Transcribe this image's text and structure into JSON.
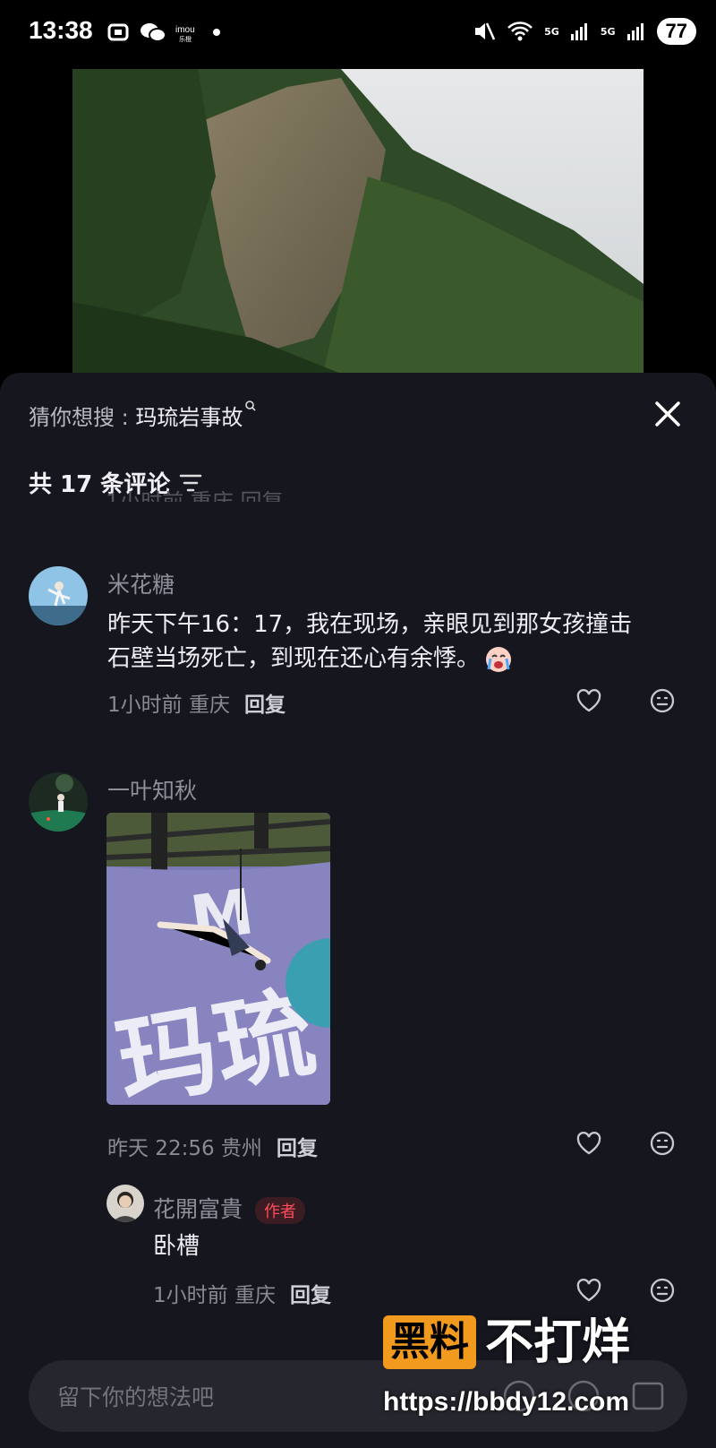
{
  "status_bar": {
    "time": "13:38",
    "battery": "77",
    "net1": "5G",
    "net2": "5G"
  },
  "sheet": {
    "suggest_prefix": "猜你想搜 : ",
    "suggest_keyword": "玛琉岩事故",
    "comment_count": "共 17 条评论",
    "partial_meta": "1小时前 重庆 回复"
  },
  "comments": [
    {
      "user": "米花糖",
      "text_line1": "昨天下午16：17，我在现场，亲眼见到那女孩撞击",
      "text_line2": "石壁当场死亡，到现在还心有余悸。",
      "time": "1小时前",
      "location": "重庆",
      "reply": "回复"
    },
    {
      "user": "一叶知秋",
      "time": "昨天 22:56",
      "location": "贵州",
      "reply": "回复",
      "image_overlay_text": "玛琉"
    },
    {
      "user": "花開富貴",
      "badge": "作者",
      "text": "卧槽",
      "time": "1小时前",
      "location": "重庆",
      "reply": "回复"
    }
  ],
  "input": {
    "placeholder": "留下你的想法吧"
  },
  "watermark": {
    "box": "黑料",
    "text": "不打烊",
    "url": "https://bbdy12.com"
  },
  "colors": {
    "sheet_bg": "#16161e",
    "author_badge": "#ff4d5c",
    "watermark_orange": "#f29a1e"
  },
  "icons": [
    "notification-icon",
    "wechat-icon",
    "imou-icon",
    "mute-icon",
    "wifi-icon",
    "signal-icon",
    "close-icon",
    "filter-icon",
    "heart-icon",
    "reaction-icon"
  ]
}
